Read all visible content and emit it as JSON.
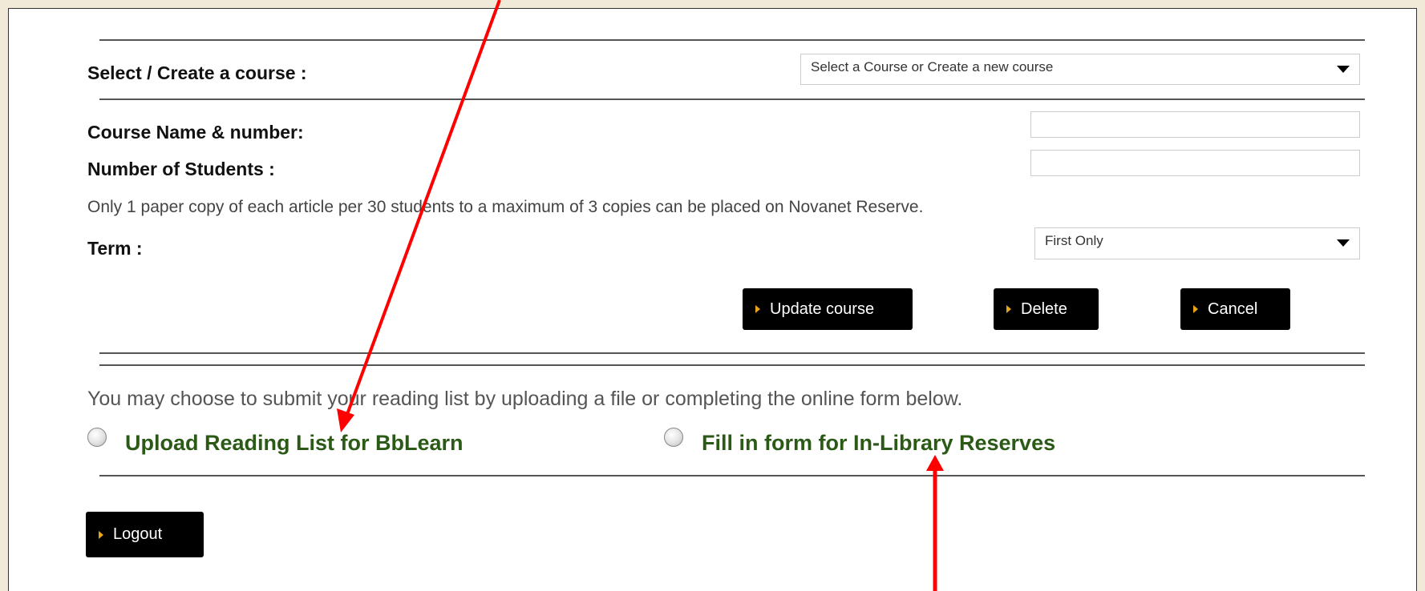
{
  "course": {
    "select_label": "Select / Create a course :",
    "select_value": "Select a Course or Create a new course",
    "name_label": "Course Name & number:",
    "name_value": "",
    "students_label": "Number of Students :",
    "students_value": "",
    "copies_note": "Only 1 paper copy of each article per 30 students to a maximum of 3 copies can be placed on Novanet Reserve.",
    "term_label": "Term :",
    "term_value": "First Only"
  },
  "actions": {
    "update_label": "Update course",
    "delete_label": "Delete",
    "cancel_label": "Cancel"
  },
  "submission": {
    "intro": "You may choose to submit your reading list by uploading a file or completing the online form below.",
    "option_upload": "Upload Reading List for BbLearn",
    "option_form": "Fill in form for In-Library Reserves"
  },
  "footer": {
    "logout_label": "Logout"
  },
  "colors": {
    "annotation_arrow": "#ff0000",
    "option_text": "#2b5a16",
    "button_bg": "#000000",
    "button_marker": "#e8a51a",
    "frame_bg": "#f1ead9"
  }
}
